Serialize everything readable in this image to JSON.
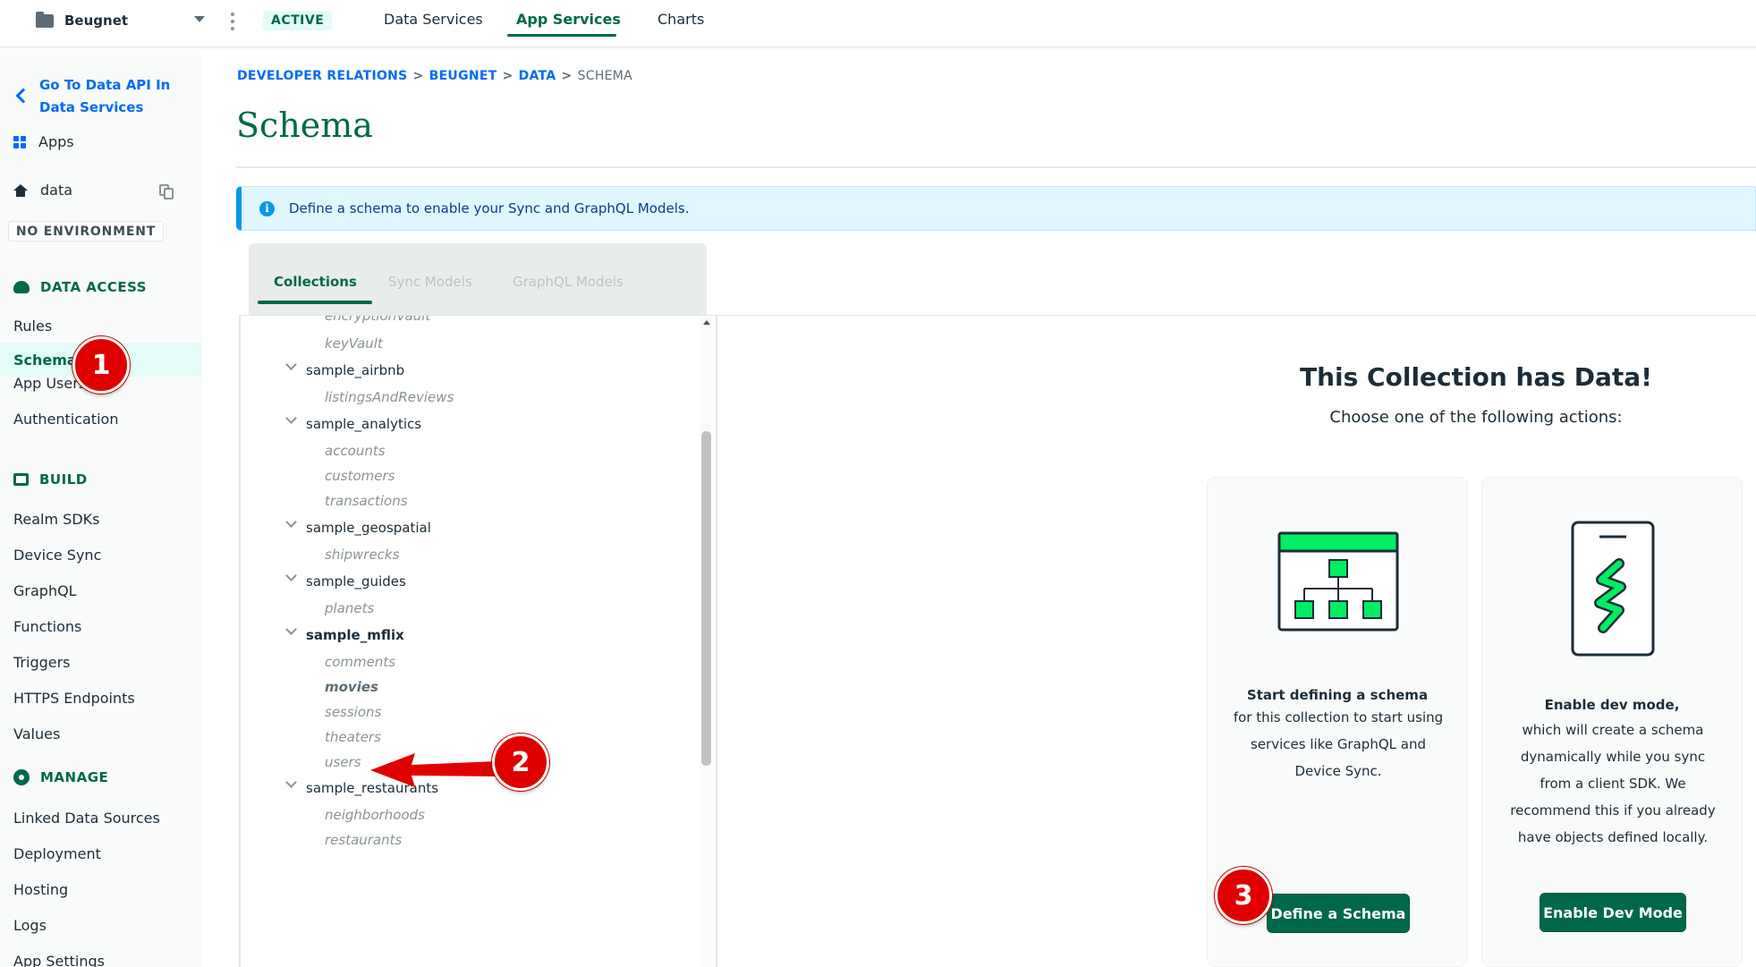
{
  "topbar": {
    "project": "Beugnet",
    "status_badge": "ACTIVE",
    "nav": [
      {
        "label": "Data Services",
        "active": false
      },
      {
        "label": "App Services",
        "active": true
      },
      {
        "label": "Charts",
        "active": false
      }
    ]
  },
  "sidebar": {
    "back_link": "Go To Data API In Data Services",
    "apps_label": "Apps",
    "app_name": "data",
    "environment": "NO ENVIRONMENT",
    "sections": [
      {
        "title": "DATA ACCESS",
        "icon": "cloud-icon",
        "items": [
          "Rules",
          "Schema",
          "App Users",
          "Authentication"
        ],
        "selected": "Schema"
      },
      {
        "title": "BUILD",
        "icon": "build-icon",
        "items": [
          "Realm SDKs",
          "Device Sync",
          "GraphQL",
          "Functions",
          "Triggers",
          "HTTPS Endpoints",
          "Values"
        ]
      },
      {
        "title": "MANAGE",
        "icon": "gear-icon",
        "items": [
          "Linked Data Sources",
          "Deployment",
          "Hosting",
          "Logs",
          "App Settings"
        ]
      }
    ]
  },
  "breadcrumb": {
    "items": [
      "DEVELOPER RELATIONS",
      "BEUGNET",
      "DATA"
    ],
    "current": "SCHEMA",
    "separator": ">"
  },
  "page": {
    "title": "Schema",
    "banner": "Define a schema to enable your Sync and GraphQL Models."
  },
  "tabs": [
    {
      "label": "Collections",
      "state": "active"
    },
    {
      "label": "Sync Models",
      "state": "disabled"
    },
    {
      "label": "GraphQL Models",
      "state": "disabled"
    }
  ],
  "tree": {
    "partial_top": "encryptionVault",
    "items": [
      {
        "type": "collection",
        "label": "keyVault"
      },
      {
        "type": "database",
        "label": "sample_airbnb"
      },
      {
        "type": "collection",
        "label": "listingsAndReviews"
      },
      {
        "type": "database",
        "label": "sample_analytics"
      },
      {
        "type": "collection",
        "label": "accounts"
      },
      {
        "type": "collection",
        "label": "customers"
      },
      {
        "type": "collection",
        "label": "transactions"
      },
      {
        "type": "database",
        "label": "sample_geospatial"
      },
      {
        "type": "collection",
        "label": "shipwrecks"
      },
      {
        "type": "database",
        "label": "sample_guides"
      },
      {
        "type": "collection",
        "label": "planets"
      },
      {
        "type": "database",
        "label": "sample_mflix",
        "bold": true
      },
      {
        "type": "collection",
        "label": "comments"
      },
      {
        "type": "collection",
        "label": "movies",
        "selected": true
      },
      {
        "type": "collection",
        "label": "sessions"
      },
      {
        "type": "collection",
        "label": "theaters"
      },
      {
        "type": "collection",
        "label": "users"
      },
      {
        "type": "database",
        "label": "sample_restaurants"
      },
      {
        "type": "collection",
        "label": "neighborhoods"
      },
      {
        "type": "collection",
        "label": "restaurants"
      }
    ]
  },
  "main": {
    "heading": "This Collection has Data!",
    "subheading": "Choose one of the following actions:",
    "cards": [
      {
        "icon": "schema-tree-icon",
        "title": "Start defining a schema",
        "body": [
          "for this collection to start using",
          "services like GraphQL and",
          "Device Sync."
        ],
        "button": "Define a Schema"
      },
      {
        "icon": "dev-mode-phone-icon",
        "title": "Enable dev mode,",
        "body": [
          "which will create a schema",
          "dynamically while you sync",
          "from a client SDK. We",
          "recommend this if you already",
          "have objects defined locally."
        ],
        "button": "Enable Dev Mode"
      }
    ]
  },
  "annotations": [
    "1",
    "2",
    "3"
  ],
  "colors": {
    "brand_green": "#00684a",
    "accent_green": "#00ed64",
    "link_blue": "#016bf8",
    "annotation_red": "#e00000"
  }
}
